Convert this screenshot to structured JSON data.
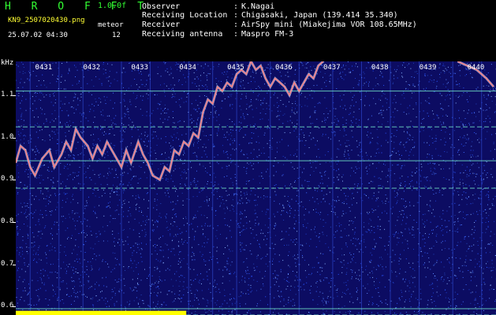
{
  "header": {
    "app_title": "H R O F F T",
    "version": "1.0.0f",
    "filename": "KN9_2507020430.png",
    "mode_label": "meteor",
    "mode_value": "12",
    "timestamp": "25.07.02 04:30"
  },
  "info": [
    {
      "key": "Observer",
      "value": "K.Nagai"
    },
    {
      "key": "Receiving Location",
      "value": "Chigasaki, Japan (139.414 35.340)"
    },
    {
      "key": "Receiver",
      "value": "AirSpy mini (Miakejima VOR 108.65MHz)"
    },
    {
      "key": "Receiving antenna",
      "value": "Maspro FM-3"
    }
  ],
  "info_separator": ":",
  "chart_data": {
    "type": "heatmap",
    "ylabel": "kHz",
    "yticks": [
      "1.1",
      "1.0",
      "0.9",
      "0.8",
      "0.7",
      "0.6"
    ],
    "ylim": [
      0.58,
      1.18
    ],
    "time_labels": [
      "0431",
      "0432",
      "0433",
      "0434",
      "0435",
      "0436",
      "0437",
      "0438",
      "0439",
      "0440"
    ],
    "xlim": [
      0,
      10
    ],
    "horizontal_lines_khz": [
      1.11,
      1.025,
      0.945,
      0.88,
      0.595,
      0.58
    ],
    "trace": [
      [
        0.0,
        0.94
      ],
      [
        0.1,
        0.98
      ],
      [
        0.2,
        0.97
      ],
      [
        0.3,
        0.93
      ],
      [
        0.4,
        0.91
      ],
      [
        0.55,
        0.95
      ],
      [
        0.7,
        0.97
      ],
      [
        0.8,
        0.93
      ],
      [
        0.95,
        0.96
      ],
      [
        1.05,
        0.99
      ],
      [
        1.15,
        0.97
      ],
      [
        1.25,
        1.02
      ],
      [
        1.35,
        1.0
      ],
      [
        1.5,
        0.98
      ],
      [
        1.6,
        0.95
      ],
      [
        1.7,
        0.98
      ],
      [
        1.8,
        0.96
      ],
      [
        1.9,
        0.99
      ],
      [
        2.0,
        0.97
      ],
      [
        2.1,
        0.95
      ],
      [
        2.2,
        0.93
      ],
      [
        2.3,
        0.97
      ],
      [
        2.4,
        0.94
      ],
      [
        2.55,
        0.99
      ],
      [
        2.65,
        0.96
      ],
      [
        2.75,
        0.94
      ],
      [
        2.85,
        0.91
      ],
      [
        3.0,
        0.9
      ],
      [
        3.1,
        0.93
      ],
      [
        3.2,
        0.92
      ],
      [
        3.3,
        0.97
      ],
      [
        3.4,
        0.96
      ],
      [
        3.5,
        0.99
      ],
      [
        3.6,
        0.98
      ],
      [
        3.7,
        1.01
      ],
      [
        3.8,
        1.0
      ],
      [
        3.9,
        1.06
      ],
      [
        4.0,
        1.09
      ],
      [
        4.1,
        1.08
      ],
      [
        4.2,
        1.12
      ],
      [
        4.3,
        1.11
      ],
      [
        4.4,
        1.13
      ],
      [
        4.5,
        1.12
      ],
      [
        4.6,
        1.15
      ],
      [
        4.7,
        1.16
      ],
      [
        4.8,
        1.15
      ],
      [
        4.9,
        1.18
      ],
      [
        5.0,
        1.16
      ],
      [
        5.1,
        1.17
      ],
      [
        5.2,
        1.14
      ],
      [
        5.3,
        1.12
      ],
      [
        5.4,
        1.14
      ],
      [
        5.5,
        1.13
      ],
      [
        5.6,
        1.12
      ],
      [
        5.7,
        1.1
      ],
      [
        5.8,
        1.13
      ],
      [
        5.9,
        1.11
      ],
      [
        6.0,
        1.13
      ],
      [
        6.1,
        1.15
      ],
      [
        6.2,
        1.14
      ],
      [
        6.3,
        1.17
      ],
      [
        6.4,
        1.18
      ]
    ],
    "trace2": [
      [
        9.2,
        1.18
      ],
      [
        9.4,
        1.17
      ],
      [
        9.6,
        1.16
      ],
      [
        9.8,
        1.14
      ],
      [
        9.95,
        1.12
      ]
    ],
    "meteor_columns": [
      0.3,
      0.9,
      1.4,
      2.2,
      2.8,
      3.6,
      4.1,
      4.6,
      5.3,
      5.9,
      6.6,
      7.2,
      7.8,
      8.4,
      9.1,
      9.7
    ],
    "bottom_bar": {
      "yellow_until": 3.55,
      "level_khz": 0.59
    },
    "colors": {
      "background": "#0c0c62",
      "noise": "#3a6cff",
      "trace": "#ff8080",
      "bar_yellow": "#ffff00",
      "bar_cyan": "#00ffff",
      "line": "#7fffd4"
    }
  }
}
